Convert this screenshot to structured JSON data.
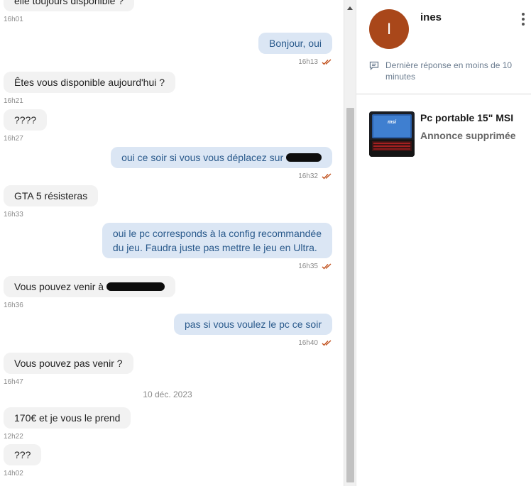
{
  "messages": [
    {
      "dir": "in",
      "text": "elle toujours disponible ?",
      "time": "16h01"
    },
    {
      "dir": "out",
      "text": "Bonjour, oui",
      "time": "16h13",
      "read": true
    },
    {
      "dir": "in",
      "text": "Êtes vous disponible aujourd'hui ?",
      "time": "16h21"
    },
    {
      "dir": "in",
      "text": "????",
      "time": "16h27"
    },
    {
      "dir": "out",
      "text": "oui ce soir si vous vous déplacez sur",
      "time": "16h32",
      "read": true
    },
    {
      "dir": "in",
      "text": "GTA 5 résisteras",
      "time": "16h33"
    },
    {
      "dir": "out",
      "text_line1": "oui le pc corresponds à la config recommandée",
      "text_line2": "du jeu. Faudra juste pas mettre le jeu en Ultra.",
      "time": "16h35",
      "read": true
    },
    {
      "dir": "in",
      "text": "Vous pouvez venir à",
      "time": "16h36"
    },
    {
      "dir": "out",
      "text": "pas si vous voulez le pc ce soir",
      "time": "16h40",
      "read": true
    },
    {
      "dir": "in",
      "text": "Vous pouvez pas venir ?",
      "time": "16h47"
    },
    {
      "dir": "in",
      "text": "170€ et je vous le prend",
      "time": "12h22"
    },
    {
      "dir": "in",
      "text": "???",
      "time": "14h02"
    }
  ],
  "date_separator": "10 déc. 2023",
  "contact": {
    "initial": "I",
    "name": "ines",
    "avatar_color": "#a9471a",
    "response_time": "Dernière réponse en moins de 10 minutes"
  },
  "listing": {
    "title": "Pc portable 15\" MSI",
    "status": "Annonce supprimée"
  },
  "colors": {
    "outgoing_bubble": "#dbe6f4",
    "incoming_bubble": "#f2f2f2",
    "read_check": "#c1501c"
  },
  "icons": {
    "read_receipt": "double-check-icon",
    "menu": "kebab-menu-icon",
    "response": "chat-bubble-icon"
  }
}
